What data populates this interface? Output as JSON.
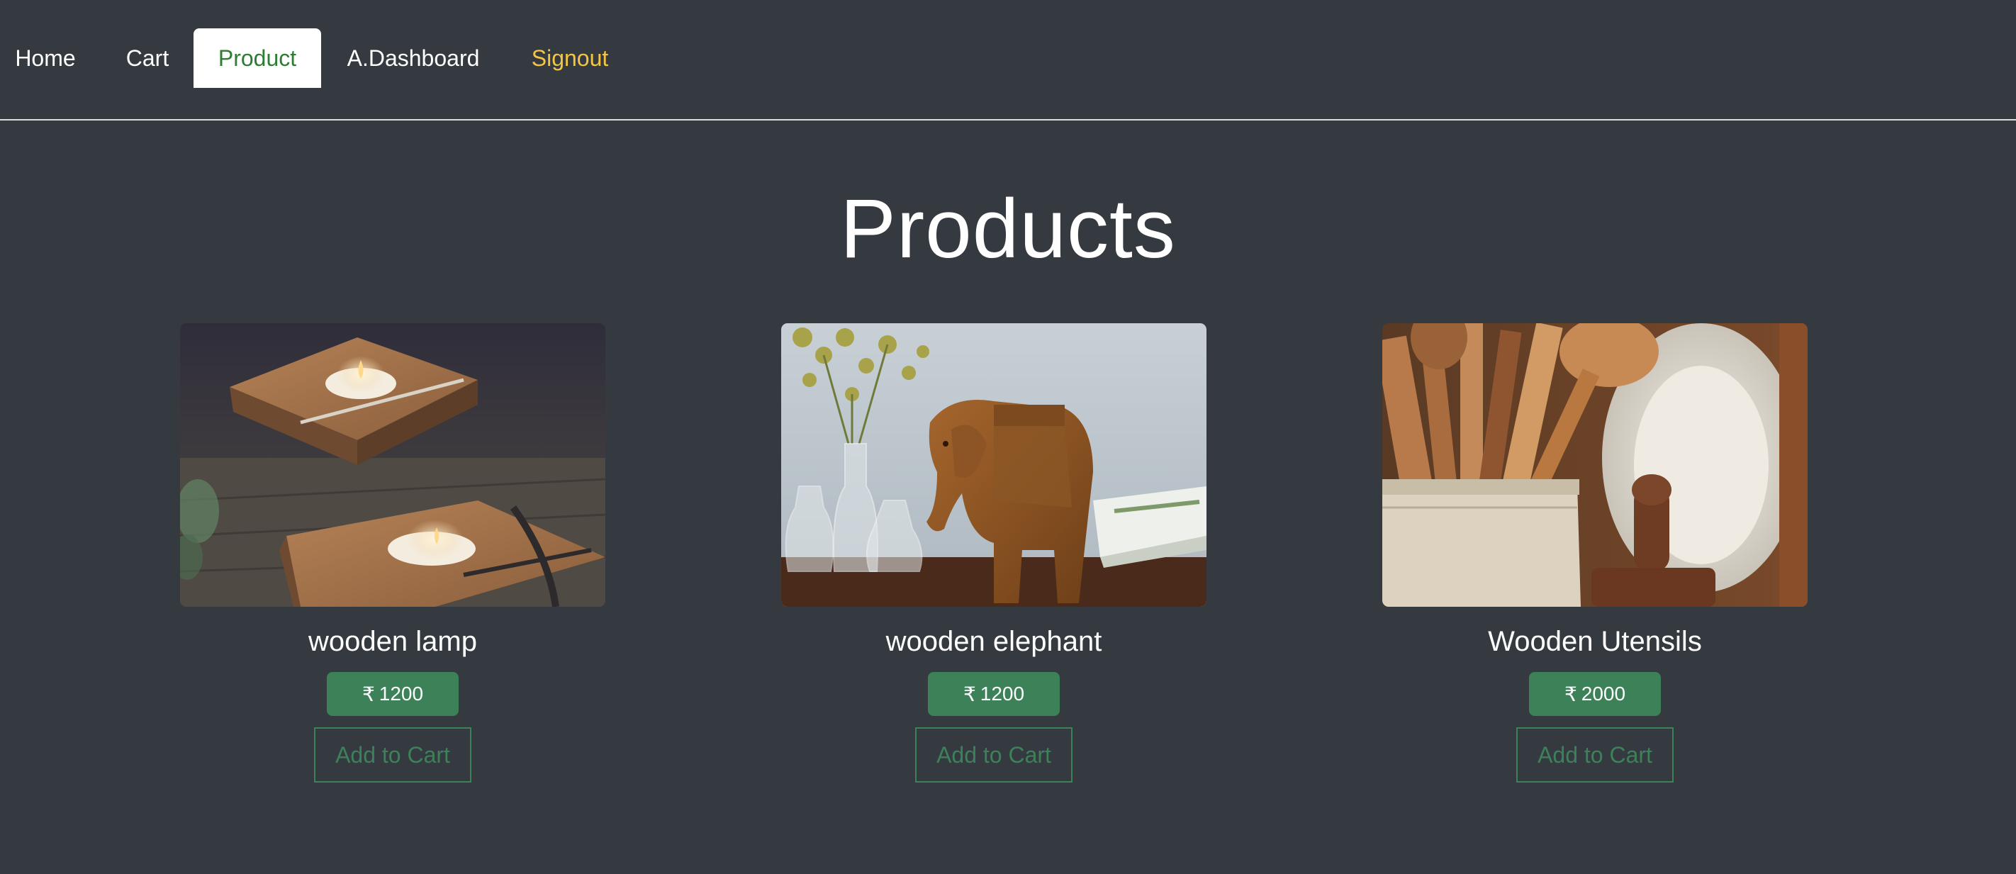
{
  "nav": {
    "home": "Home",
    "cart": "Cart",
    "product": "Product",
    "dashboard": "A.Dashboard",
    "signout": "Signout"
  },
  "page": {
    "title": "Products"
  },
  "currency_symbol": "₹",
  "products": [
    {
      "name": "wooden lamp",
      "price": "1200",
      "add_label": "Add to Cart",
      "image": "wooden-lamp-photo"
    },
    {
      "name": "wooden elephant",
      "price": "1200",
      "add_label": "Add to Cart",
      "image": "wooden-elephant-photo"
    },
    {
      "name": "Wooden Utensils",
      "price": "2000",
      "add_label": "Add to Cart",
      "image": "wooden-utensils-photo"
    }
  ],
  "colors": {
    "background": "#343a40",
    "accent_green": "#3c8158",
    "active_tab_text": "#2e7d32",
    "signout": "#f4c542"
  }
}
